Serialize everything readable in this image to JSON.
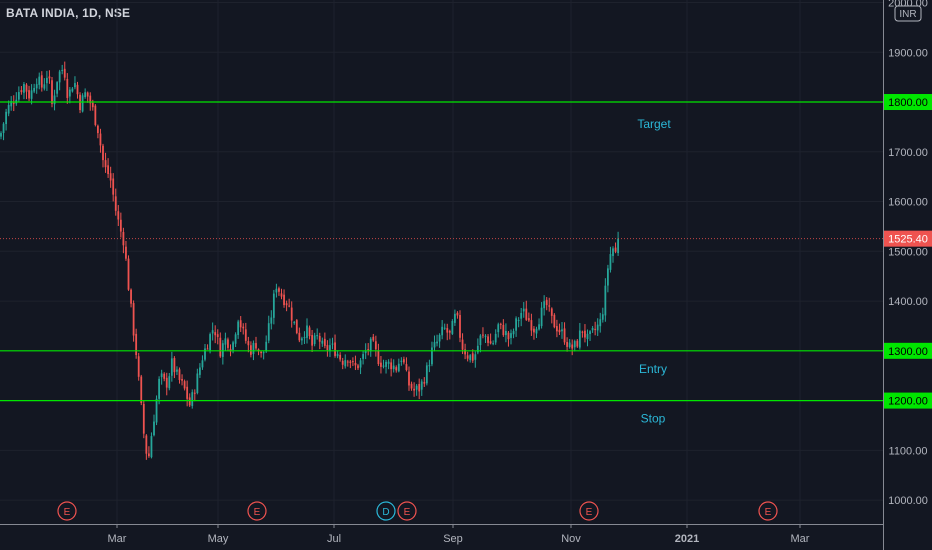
{
  "header": {
    "symbol_title": "BATA INDIA, 1D, NSE"
  },
  "currency_badge": "INR",
  "colors": {
    "background": "#131722",
    "up": "#26a69a",
    "down": "#ef5350",
    "level_line": "#00e600",
    "annotation_text": "#2bb8d8",
    "axis_text": "#b2b5be",
    "axis_line": "#868993",
    "last_price": "#ef5350"
  },
  "chart_data": {
    "type": "candlestick",
    "title": "BATA INDIA, 1D, NSE",
    "ylim": [
      952,
      2005
    ],
    "y_ticks": [
      "2000.00",
      "1900.00",
      "1800.00",
      "1700.00",
      "1600.00",
      "1500.00",
      "1400.00",
      "1300.00",
      "1200.00",
      "1100.00",
      "1000.00"
    ],
    "x_ticks": [
      "Mar",
      "May",
      "Jul",
      "Sep",
      "Nov",
      "2021",
      "Mar"
    ],
    "last_price": {
      "label": "1525.40",
      "value": 1525.4
    },
    "levels": [
      {
        "label": "1800.00",
        "value": 1800,
        "annotation": "Target"
      },
      {
        "label": "1300.00",
        "value": 1300,
        "annotation": "Entry"
      },
      {
        "label": "1200.00",
        "value": 1200,
        "annotation": "Stop"
      }
    ],
    "events": [
      {
        "type": "E",
        "x": "mid-Feb"
      },
      {
        "type": "E",
        "x": "mid-May"
      },
      {
        "type": "D",
        "x": "early Aug"
      },
      {
        "type": "E",
        "x": "early Aug"
      },
      {
        "type": "E",
        "x": "early Nov"
      },
      {
        "type": "E",
        "x": "late Jan 2021"
      }
    ],
    "close_path": [
      [
        0,
        1730
      ],
      [
        7,
        1785
      ],
      [
        12,
        1800
      ],
      [
        18,
        1820
      ],
      [
        24,
        1835
      ],
      [
        30,
        1810
      ],
      [
        36,
        1850
      ],
      [
        42,
        1830
      ],
      [
        48,
        1860
      ],
      [
        52,
        1795
      ],
      [
        58,
        1855
      ],
      [
        64,
        1870
      ],
      [
        68,
        1810
      ],
      [
        74,
        1845
      ],
      [
        80,
        1795
      ],
      [
        86,
        1820
      ],
      [
        92,
        1790
      ],
      [
        98,
        1745
      ],
      [
        104,
        1670
      ],
      [
        110,
        1650
      ],
      [
        116,
        1580
      ],
      [
        120,
        1545
      ],
      [
        124,
        1520
      ],
      [
        128,
        1440
      ],
      [
        132,
        1365
      ],
      [
        136,
        1300
      ],
      [
        140,
        1210
      ],
      [
        144,
        1130
      ],
      [
        148,
        1075
      ],
      [
        152,
        1140
      ],
      [
        156,
        1195
      ],
      [
        160,
        1250
      ],
      [
        166,
        1230
      ],
      [
        172,
        1275
      ],
      [
        178,
        1245
      ],
      [
        184,
        1225
      ],
      [
        190,
        1190
      ],
      [
        196,
        1235
      ],
      [
        202,
        1285
      ],
      [
        208,
        1320
      ],
      [
        214,
        1350
      ],
      [
        220,
        1300
      ],
      [
        226,
        1325
      ],
      [
        232,
        1305
      ],
      [
        238,
        1370
      ],
      [
        244,
        1330
      ],
      [
        250,
        1300
      ],
      [
        256,
        1315
      ],
      [
        262,
        1285
      ],
      [
        268,
        1335
      ],
      [
        272,
        1380
      ],
      [
        276,
        1435
      ],
      [
        282,
        1410
      ],
      [
        288,
        1395
      ],
      [
        294,
        1355
      ],
      [
        300,
        1325
      ],
      [
        306,
        1345
      ],
      [
        312,
        1310
      ],
      [
        318,
        1330
      ],
      [
        324,
        1300
      ],
      [
        330,
        1310
      ],
      [
        336,
        1300
      ],
      [
        342,
        1280
      ],
      [
        348,
        1290
      ],
      [
        354,
        1265
      ],
      [
        360,
        1275
      ],
      [
        366,
        1300
      ],
      [
        372,
        1315
      ],
      [
        378,
        1285
      ],
      [
        384,
        1270
      ],
      [
        390,
        1275
      ],
      [
        396,
        1265
      ],
      [
        402,
        1290
      ],
      [
        408,
        1235
      ],
      [
        414,
        1220
      ],
      [
        420,
        1225
      ],
      [
        426,
        1255
      ],
      [
        432,
        1300
      ],
      [
        438,
        1320
      ],
      [
        444,
        1345
      ],
      [
        450,
        1330
      ],
      [
        456,
        1375
      ],
      [
        462,
        1310
      ],
      [
        468,
        1290
      ],
      [
        474,
        1285
      ],
      [
        480,
        1325
      ],
      [
        486,
        1330
      ],
      [
        492,
        1310
      ],
      [
        498,
        1350
      ],
      [
        504,
        1340
      ],
      [
        510,
        1320
      ],
      [
        516,
        1355
      ],
      [
        522,
        1380
      ],
      [
        528,
        1365
      ],
      [
        534,
        1345
      ],
      [
        540,
        1370
      ],
      [
        546,
        1395
      ],
      [
        552,
        1360
      ],
      [
        558,
        1345
      ],
      [
        564,
        1330
      ],
      [
        570,
        1305
      ],
      [
        576,
        1310
      ],
      [
        582,
        1345
      ],
      [
        588,
        1320
      ],
      [
        594,
        1340
      ],
      [
        600,
        1355
      ],
      [
        604,
        1395
      ],
      [
        608,
        1470
      ],
      [
        612,
        1510
      ],
      [
        616,
        1495
      ],
      [
        620,
        1525
      ]
    ]
  }
}
